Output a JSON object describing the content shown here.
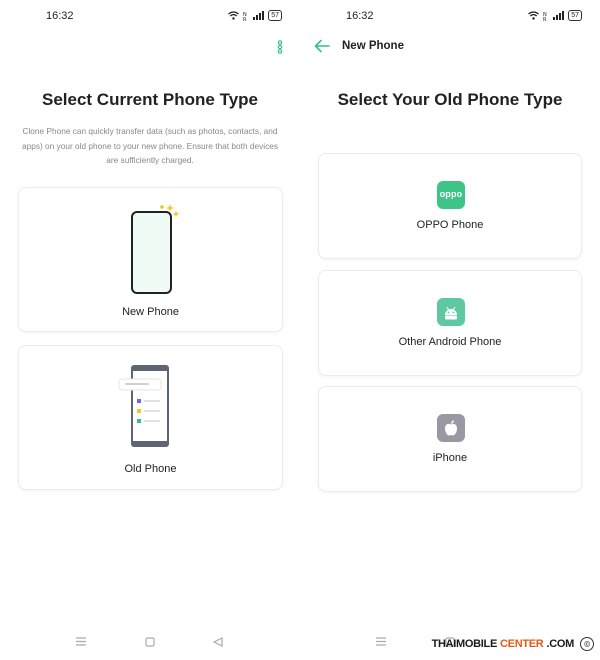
{
  "colors": {
    "accent": "#2ec08e",
    "oppo_green": "#3ec486",
    "android_green": "#5ec9a0",
    "iphone_gray": "#9a99a3",
    "watermark_orange": "#e25b14"
  },
  "left_screen": {
    "status": {
      "time": "16:32",
      "battery": "57"
    },
    "title": "Select Current Phone Type",
    "description": "Clone Phone can quickly transfer data (such as photos, contacts, and apps) on your old phone to your new phone. Ensure that both devices are sufficiently charged.",
    "options": [
      {
        "label": "New Phone",
        "icon": "new-phone-illustration"
      },
      {
        "label": "Old Phone",
        "icon": "old-phone-illustration"
      }
    ]
  },
  "right_screen": {
    "status": {
      "time": "16:32",
      "battery": "57"
    },
    "header_title": "New Phone",
    "title": "Select Your Old Phone Type",
    "options": [
      {
        "label": "OPPO Phone",
        "icon": "oppo-logo-icon",
        "icon_text": "oppo"
      },
      {
        "label": "Other Android Phone",
        "icon": "android-icon"
      },
      {
        "label": "iPhone",
        "icon": "apple-icon"
      }
    ]
  },
  "watermark": {
    "part1": "THAIMOBILE",
    "part2": "CENTER",
    "part3": ".COM",
    "logo": "©"
  }
}
